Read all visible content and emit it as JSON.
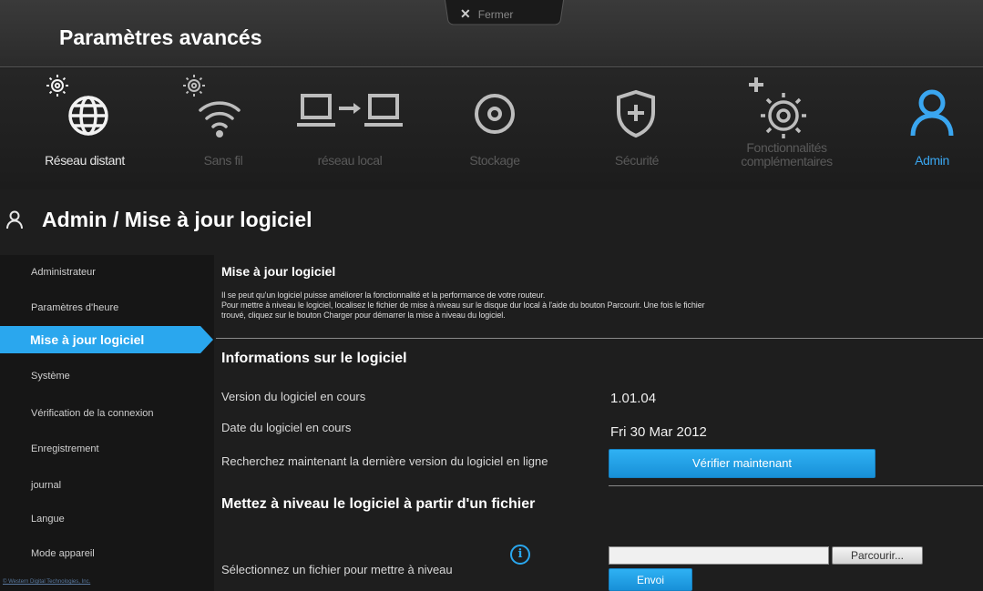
{
  "header": {
    "title": "Paramètres avancés",
    "close_label": "Fermer",
    "close_glyph": "✕"
  },
  "nav": [
    {
      "label": "Réseau distant",
      "icon": "globe-gear-icon"
    },
    {
      "label": "Sans fil",
      "icon": "wifi-gear-icon"
    },
    {
      "label": "réseau local",
      "icon": "laptop-to-laptop-icon"
    },
    {
      "label": "Stockage",
      "icon": "disc-icon"
    },
    {
      "label": "Sécurité",
      "icon": "shield-plus-icon"
    },
    {
      "label": "Fonctionnalités complémentaires",
      "icon": "gear-plus-icon"
    },
    {
      "label": "Admin",
      "icon": "user-icon"
    }
  ],
  "page_title": "Admin / Mise à jour logiciel",
  "sidebar": {
    "items": [
      {
        "label": "Administrateur"
      },
      {
        "label": "Paramètres d'heure"
      },
      {
        "label": "Mise à jour logiciel"
      },
      {
        "label": "Système"
      },
      {
        "label": "Vérification de la connexion"
      },
      {
        "label": "Enregistrement"
      },
      {
        "label": "journal"
      },
      {
        "label": "Langue"
      },
      {
        "label": "Mode appareil"
      }
    ],
    "active_index": 2,
    "copyright": "© Western Digital Technologies, Inc."
  },
  "main": {
    "section_title": "Mise à jour logiciel",
    "description": [
      "Il se peut qu'un logiciel puisse améliorer la fonctionnalité et la performance de votre routeur.",
      "Pour mettre à niveau le logiciel, localisez le fichier de mise à niveau sur le disque dur local à l'aide du bouton Parcourir. Une fois le fichier",
      "trouvé, cliquez sur le bouton Charger pour démarrer la mise à niveau du logiciel."
    ],
    "info_title": "Informations sur le logiciel",
    "version_label": "Version du logiciel en cours",
    "version_value": "1.01.04",
    "date_label": "Date du logiciel en cours",
    "date_value": "Fri 30 Mar 2012",
    "check_label": "Recherchez maintenant la dernière version du logiciel en ligne",
    "check_button": "Vérifier maintenant",
    "upgrade_title": "Mettez à niveau le logiciel à partir d'un fichier",
    "select_label": "Sélectionnez un fichier pour mettre à niveau",
    "file_value": "",
    "browse_button": "Parcourir...",
    "send_button": "Envoi"
  },
  "colors": {
    "accent": "#2aa7ee",
    "background": "#1e1e1e",
    "inactive_nav": "#5a5a5a"
  }
}
